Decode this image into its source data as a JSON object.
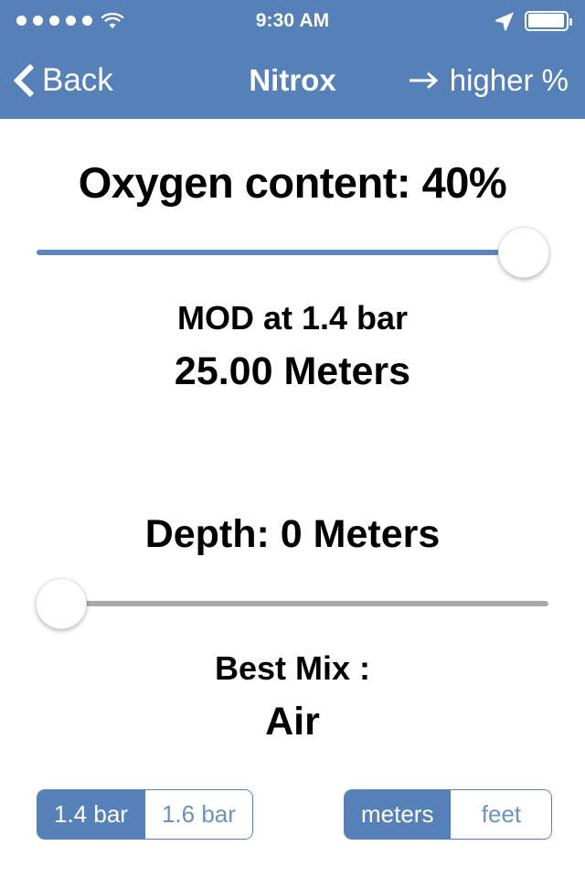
{
  "statusbar": {
    "signal_dots": 5,
    "wifi_icon": "wifi-icon",
    "time": "9:30 AM",
    "location_icon": "location-arrow-icon",
    "battery_icon": "battery-full-icon"
  },
  "navbar": {
    "back_label": "Back",
    "back_icon": "chevron-left-icon",
    "title": "Nitrox",
    "right_action_icon": "arrow-right-icon",
    "right_action_label": "higher %",
    "background_color": "#5580b8"
  },
  "main": {
    "oxygen": {
      "label": "Oxygen content: 40%",
      "slider_value": 40,
      "slider_min": 21,
      "slider_max": 40,
      "slider_position_percent": 100
    },
    "mod": {
      "label": "MOD at 1.4 bar",
      "value": "25.00 Meters"
    },
    "depth": {
      "label": "Depth: 0 Meters",
      "slider_value": 0,
      "slider_min": 0,
      "slider_max": 100,
      "slider_position_percent": 0
    },
    "best_mix": {
      "label": "Best Mix :",
      "value": "Air"
    }
  },
  "controls": {
    "pressure": {
      "options": [
        "1.4 bar",
        "1.6 bar"
      ],
      "selected_index": 0
    },
    "units": {
      "options": [
        "meters",
        "feet"
      ],
      "selected_index": 0
    }
  },
  "colors": {
    "accent": "#5580b8",
    "slider_fill": "#5b86ba",
    "slider_track": "#a9a9a9",
    "segment_text": "#6a93c4"
  }
}
